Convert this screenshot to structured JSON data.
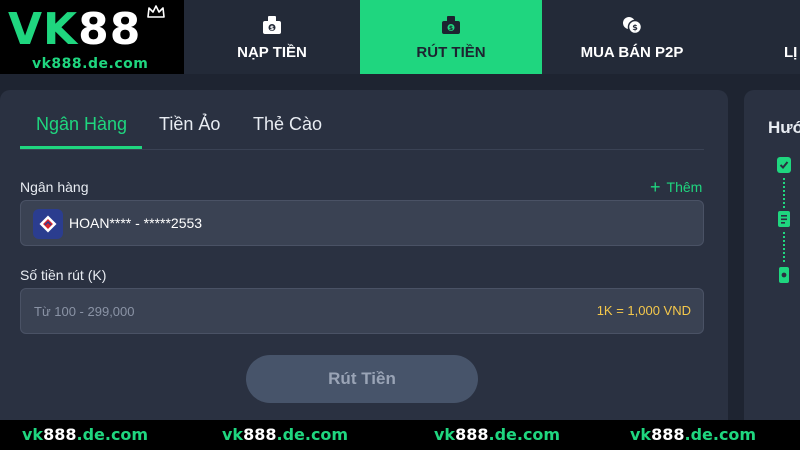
{
  "brand": {
    "logo_vk": "VK",
    "logo_88": "88",
    "logo_url": "vk888.de.com"
  },
  "nav": {
    "tabs": [
      {
        "label": "NẠP TIỀN",
        "icon": "deposit-icon",
        "active": false
      },
      {
        "label": "RÚT TIỀN",
        "icon": "withdraw-icon",
        "active": true
      },
      {
        "label": "MUA BÁN P2P",
        "icon": "coins-icon",
        "active": false
      },
      {
        "label": "LỊ",
        "icon": "",
        "active": false
      }
    ]
  },
  "panel": {
    "tabs": [
      {
        "label": "Ngân Hàng",
        "active": true
      },
      {
        "label": "Tiền Ảo",
        "active": false
      },
      {
        "label": "Thẻ Cào",
        "active": false
      }
    ],
    "bank_label": "Ngân hàng",
    "add_label": "Thêm",
    "bank_value": "HOAN**** - *****2553",
    "amount_label": "Số tiền rút (K)",
    "amount_placeholder": "Từ 100 - 299,000",
    "rate": "1K = 1,000 VND",
    "submit_label": "Rút Tiền"
  },
  "side": {
    "title": "Hướ"
  },
  "watermark": {
    "items": [
      {
        "a": "vk",
        "b": "888",
        "c": ".de.com"
      },
      {
        "a": "vk",
        "b": "888",
        "c": ".de.com"
      },
      {
        "a": "vk",
        "b": "888",
        "c": ".de.com"
      },
      {
        "a": "vk",
        "b": "888",
        "c": ".de.com"
      }
    ]
  },
  "colors": {
    "accent": "#1fd67f",
    "background": "#1e2431",
    "panel": "#2a3141",
    "rate": "#f5c84b"
  }
}
